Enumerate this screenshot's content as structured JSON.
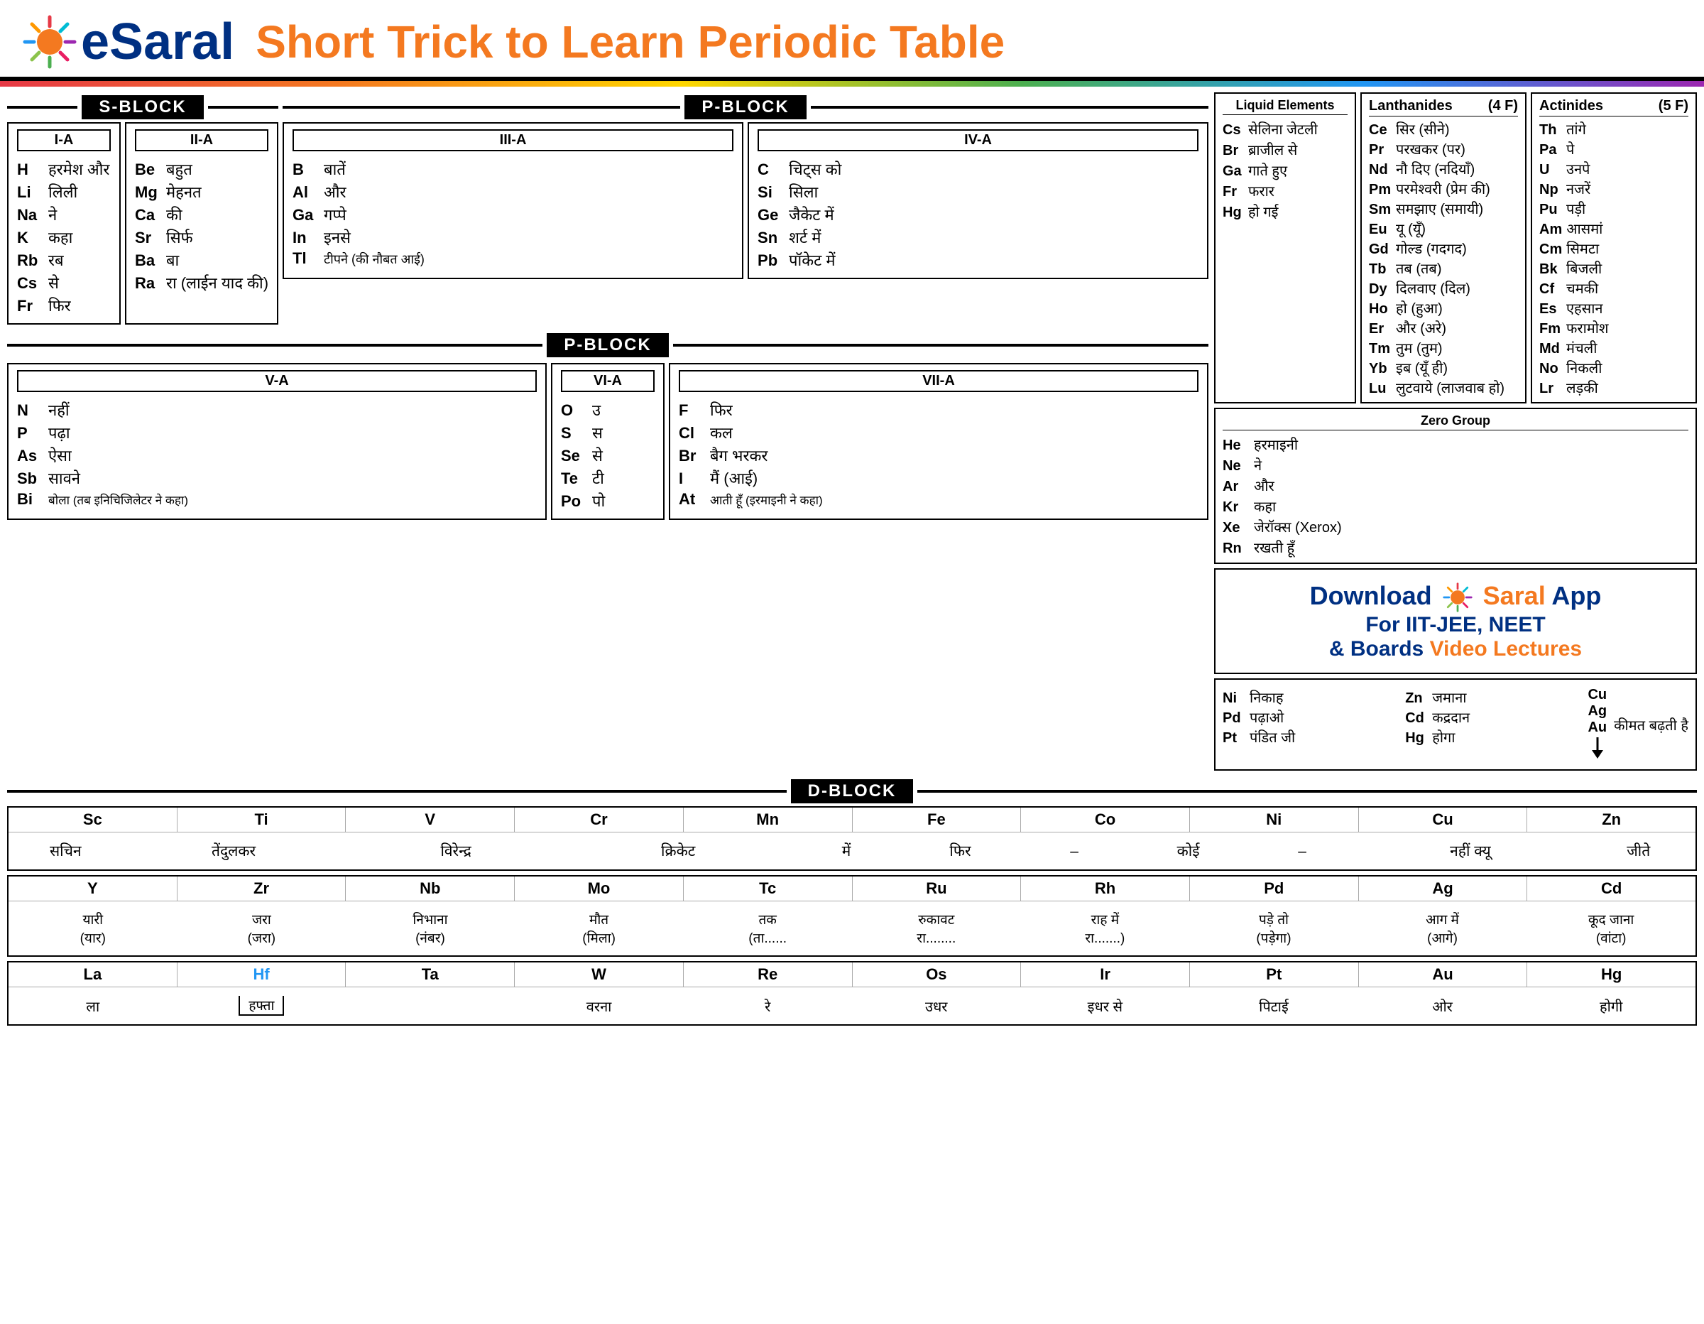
{
  "header": {
    "logo": "eSaral",
    "subtitle": "Short Trick to ",
    "subtitle_highlight": "Learn Periodic Table"
  },
  "s_block": {
    "label": "S-BLOCK",
    "groups": {
      "ia": {
        "title": "I-A",
        "elements": [
          {
            "symbol": "H",
            "text": "हरमेश और"
          },
          {
            "symbol": "Li",
            "text": "लिली"
          },
          {
            "symbol": "Na",
            "text": "ने"
          },
          {
            "symbol": "K",
            "text": "कहा"
          },
          {
            "symbol": "Rb",
            "text": "रब"
          },
          {
            "symbol": "Cs",
            "text": "से"
          },
          {
            "symbol": "Fr",
            "text": "फिर"
          }
        ]
      },
      "iia": {
        "title": "II-A",
        "elements": [
          {
            "symbol": "Be",
            "text": "बहुत"
          },
          {
            "symbol": "Mg",
            "text": "मेहनत"
          },
          {
            "symbol": "Ca",
            "text": "की"
          },
          {
            "symbol": "Sr",
            "text": "सिर्फ"
          },
          {
            "symbol": "Ba",
            "text": "बा"
          },
          {
            "symbol": "Ra",
            "text": "रा (लाईन याद की)"
          }
        ]
      }
    }
  },
  "p_block_top": {
    "label": "P-BLOCK",
    "groups": {
      "iiia": {
        "title": "III-A",
        "elements": [
          {
            "symbol": "B",
            "text": "बातें"
          },
          {
            "symbol": "Al",
            "text": "और"
          },
          {
            "symbol": "Ga",
            "text": "गप्पे"
          },
          {
            "symbol": "In",
            "text": "इनसे"
          },
          {
            "symbol": "Tl",
            "text": "टीपने (की नौबत आई)"
          }
        ]
      },
      "iva": {
        "title": "IV-A",
        "elements": [
          {
            "symbol": "C",
            "text": "चिट्स को"
          },
          {
            "symbol": "Si",
            "text": "सिला"
          },
          {
            "symbol": "Ge",
            "text": "जैकेट में"
          },
          {
            "symbol": "Sn",
            "text": "शर्ट में"
          },
          {
            "symbol": "Pb",
            "text": "पॉकेट में"
          }
        ]
      }
    }
  },
  "liquid_elements": {
    "title": "Liquid Elements",
    "elements": [
      {
        "symbol": "Cs",
        "text": "सेलिना जेटली"
      },
      {
        "symbol": "Br",
        "text": "ब्राजील से"
      },
      {
        "symbol": "Ga",
        "text": "गाते हुए"
      },
      {
        "symbol": "Fr",
        "text": "फरार"
      },
      {
        "symbol": "Hg",
        "text": "हो गई"
      }
    ]
  },
  "lanthanides": {
    "title": "Lanthanides",
    "f_count": "(4 F)",
    "elements": [
      {
        "symbol": "Ce",
        "text": "सिर (सीने)"
      },
      {
        "symbol": "Pr",
        "text": "परखकर (पर)"
      },
      {
        "symbol": "Nd",
        "text": "नौ दिए (नदियाँ)"
      },
      {
        "symbol": "Pm",
        "text": "परमेश्वरी   (प्रेम की)"
      },
      {
        "symbol": "Sm",
        "text": "समझाए (समायी)"
      },
      {
        "symbol": "Eu",
        "text": "यू    (यूँ)"
      },
      {
        "symbol": "Gd",
        "text": "गोल्ड  (गदगद)"
      },
      {
        "symbol": "Tb",
        "text": "तब   (तब)"
      },
      {
        "symbol": "Dy",
        "text": "दिलवाए (दिल)"
      },
      {
        "symbol": "Ho",
        "text": "हो    (हुआ)"
      },
      {
        "symbol": "Er",
        "text": "और   (अरे)"
      },
      {
        "symbol": "Tm",
        "text": "तुम   (तुम)"
      },
      {
        "symbol": "Yb",
        "text": "इब   (यूँ ही)"
      },
      {
        "symbol": "Lu",
        "text": "लुटवाये (लाजवाब हो)"
      }
    ]
  },
  "actinides": {
    "title": "Actinides",
    "f_count": "(5 F)",
    "elements": [
      {
        "symbol": "Th",
        "text": "तांगे"
      },
      {
        "symbol": "Pa",
        "text": "पे"
      },
      {
        "symbol": "U",
        "text": "उनपे"
      },
      {
        "symbol": "Np",
        "text": "नजरें"
      },
      {
        "symbol": "Pu",
        "text": "पड़ी"
      },
      {
        "symbol": "Am",
        "text": "आसमां"
      },
      {
        "symbol": "Cm",
        "text": "सिमटा"
      },
      {
        "symbol": "Bk",
        "text": "बिजली"
      },
      {
        "symbol": "Cf",
        "text": "चमकी"
      },
      {
        "symbol": "Es",
        "text": "एहसान"
      },
      {
        "symbol": "Fm",
        "text": "फरामोश"
      },
      {
        "symbol": "Md",
        "text": "मंचली"
      },
      {
        "symbol": "No",
        "text": "निकली"
      },
      {
        "symbol": "Lr",
        "text": "लड़की"
      }
    ]
  },
  "p_block_bottom": {
    "label": "P-BLOCK",
    "groups": {
      "va": {
        "title": "V-A",
        "elements": [
          {
            "symbol": "N",
            "text": "नहीं"
          },
          {
            "symbol": "P",
            "text": "पढ़ा"
          },
          {
            "symbol": "As",
            "text": "ऐसा"
          },
          {
            "symbol": "Sb",
            "text": "सावने"
          },
          {
            "symbol": "Bi",
            "text": "बोला (तब इनिचिजिलेटर ने कहा)"
          }
        ]
      },
      "via": {
        "title": "VI-A",
        "elements": [
          {
            "symbol": "O",
            "text": "उ"
          },
          {
            "symbol": "S",
            "text": "स"
          },
          {
            "symbol": "Se",
            "text": "से"
          },
          {
            "symbol": "Te",
            "text": "टी"
          },
          {
            "symbol": "Po",
            "text": "पो"
          }
        ]
      },
      "viia": {
        "title": "VII-A",
        "elements": [
          {
            "symbol": "F",
            "text": "फिर"
          },
          {
            "symbol": "Cl",
            "text": "कल"
          },
          {
            "symbol": "Br",
            "text": "बैग भरकर"
          },
          {
            "symbol": "I",
            "text": "मैं (आई)"
          },
          {
            "symbol": "At",
            "text": "आती हूँ (इरमाइनी ने कहा)"
          }
        ]
      }
    }
  },
  "zero_group": {
    "title": "Zero Group",
    "elements": [
      {
        "symbol": "He",
        "text": "हरमाइनी"
      },
      {
        "symbol": "Ne",
        "text": "ने"
      },
      {
        "symbol": "Ar",
        "text": "और"
      },
      {
        "symbol": "Kr",
        "text": "कहा"
      },
      {
        "symbol": "Xe",
        "text": "जेरॉक्स (Xerox)"
      },
      {
        "symbol": "Rn",
        "text": "रखती हूँ"
      }
    ]
  },
  "d_block": {
    "label": "D-BLOCK",
    "row1": {
      "symbols": [
        "Sc",
        "Ti",
        "V",
        "Cr",
        "Mn",
        "Fe",
        "Co",
        "Ni",
        "Cu",
        "Zn"
      ],
      "texts": [
        "सचिन",
        "तेंदुलकर",
        "विरेन्द्र",
        "क्रिकेट",
        "में",
        "फिर",
        "–",
        "कोई",
        "–",
        "नहीं",
        "क्यू",
        "",
        "जीते"
      ]
    },
    "row1_text": "सचिन   तेंदुलकर   विरेन्द्र   क्रिकेट   में   फिर – कोई – नहीं   क्यू   जीते",
    "row2": {
      "symbols": [
        "Y",
        "Zr",
        "Nb",
        "Mo",
        "Tc",
        "Ru",
        "Rh",
        "Pd",
        "Ag",
        "Cd"
      ],
      "texts": [
        "यारी (यार)",
        "जरा (जरा)",
        "निभाना (नंबर)",
        "मौत (मिला)",
        "तक (ता......",
        "रुकावट रा........",
        "राह में रा.......)",
        "पड़े तो (पड़ेगा)",
        "आग में (आगे)",
        "कूद जाना (वांटा)"
      ]
    },
    "row3": {
      "symbols": [
        "La",
        "Hf",
        "Ta",
        "W",
        "Re",
        "Os",
        "Ir",
        "Pt",
        "Au",
        "Hg"
      ],
      "texts": [
        "ला",
        "हफ्ता",
        "वरना",
        "रे",
        "उधर",
        "इधर से",
        "पिटाई",
        "ओर",
        "होगी"
      ]
    }
  },
  "price_table": {
    "rows": [
      {
        "sym1": "Ni",
        "text1": "निकाह",
        "sym2": "Zn",
        "text2": "जमाना"
      },
      {
        "sym1": "Pd",
        "text1": "पढ़ाओ",
        "sym2": "Cd",
        "text2": "कद्रदान"
      },
      {
        "sym1": "Pt",
        "text1": "पंडित जी",
        "sym2": "Hg",
        "text2": "होगा"
      }
    ],
    "price_title": "कीमत बढ़ती है",
    "price_items": [
      "Cu",
      "Ag",
      "Au"
    ]
  },
  "download": {
    "line1": "Download ",
    "logo": "eSaral",
    "line1_end": " App",
    "line2": "For IIT-JEE, NEET",
    "line3": "& Boards ",
    "line3_highlight": "Video Lectures"
  }
}
